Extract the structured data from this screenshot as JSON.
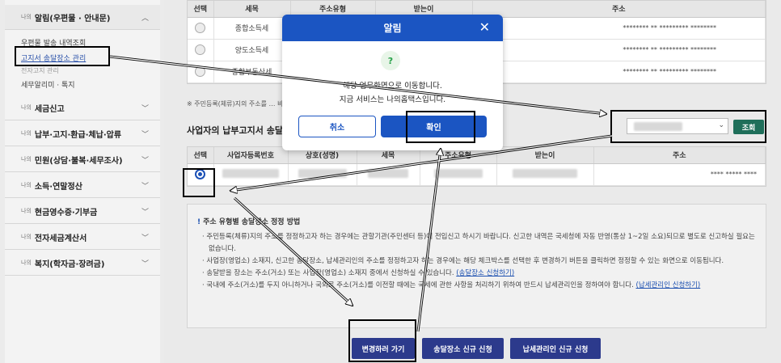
{
  "sidebar": {
    "prefix": "나의",
    "menus": [
      {
        "label": "알림(우편물 · 안내문)",
        "open": true
      },
      {
        "label": "세금신고"
      },
      {
        "label": "납부·고지·환급·체납·압류"
      },
      {
        "label": "민원(상담·불복·세무조사)"
      },
      {
        "label": "소득·연말정산"
      },
      {
        "label": "현금영수증·기부금"
      },
      {
        "label": "전자세금계산서"
      },
      {
        "label": "복지(학자금·장려금)"
      }
    ],
    "subitems": [
      "우편물 발송 내역조회",
      "고지서 송달장소 관리",
      "전자고지 관리",
      "세무알리미 · 톡지"
    ]
  },
  "top_table": {
    "headers": [
      "선택",
      "세목",
      "주소유형",
      "받는이",
      "주소"
    ],
    "rows": [
      {
        "tax": "종합소득세",
        "recv": "이하",
        "addr": "******** ** ********* ********"
      },
      {
        "tax": "양도소득세",
        "recv": "이하",
        "addr": "******** ** ********* ********"
      },
      {
        "tax": "종합부동산세",
        "recv": "이하",
        "addr": "******** ** ********* ********"
      }
    ]
  },
  "note": "※ 주민등록(체류)지의 주소를 … 바랍니다.",
  "business": {
    "title": "사업자의 납부고지서 송달",
    "lookup_label": "조회",
    "headers": [
      "선택",
      "사업자등록번호",
      "상호(성명)",
      "세목",
      "주소유형",
      "받는이",
      "주소"
    ],
    "row_addr": "**** ***** ****"
  },
  "guide": {
    "title": "주소 유형별 송달장소 정정 방법",
    "items": [
      "주민등록(체류)지의 주소를 정정하고자 하는 경우에는 관할기관(주민센터 등)에 전입신고 하시기 바랍니다. 신고한 내역은 국세청에 자동 반영(통상 1~2일 소요)되므로 별도로 신고하실 필요는 없습니다.",
      "사업장(영업소) 소재지, 신고한 송달장소, 납세관리인의 주소를 정정하고자 하는 경우에는 해당 체크박스를 선택한 후 변경하기 버튼을 클릭하면 정정할 수 있는 화면으로 이동됩니다.",
      "송달받을 장소는 주소(거소) 또는 사업장(영업소) 소재지 중에서 신청하실 수 있습니다.",
      "국내에 주소(거소)를 두지 아니하거나 국외로 주소(거소)를 이전할 때에는 국세에 관한 사항을 처리하기 위하여 반드시 납세관리인을 정하여야 합니다."
    ],
    "link1": "(송달장소 신청하기)",
    "link2": "(납세관리인 신청하기)"
  },
  "buttons": {
    "change": "변경하러 가기",
    "new_place": "송달장소 신규 신청",
    "new_agent": "납세관리인 신규 신청"
  },
  "modal": {
    "title": "알림",
    "icon": "?",
    "line1": "해당 업무화면으로 이동합니다.",
    "line2": "지금 서비스는 나의홈택스입니다.",
    "cancel": "취소",
    "ok": "확인"
  },
  "colors": {
    "primary": "#1b55c2",
    "button": "#2c3a8c",
    "lookup": "#1f6f5a"
  }
}
